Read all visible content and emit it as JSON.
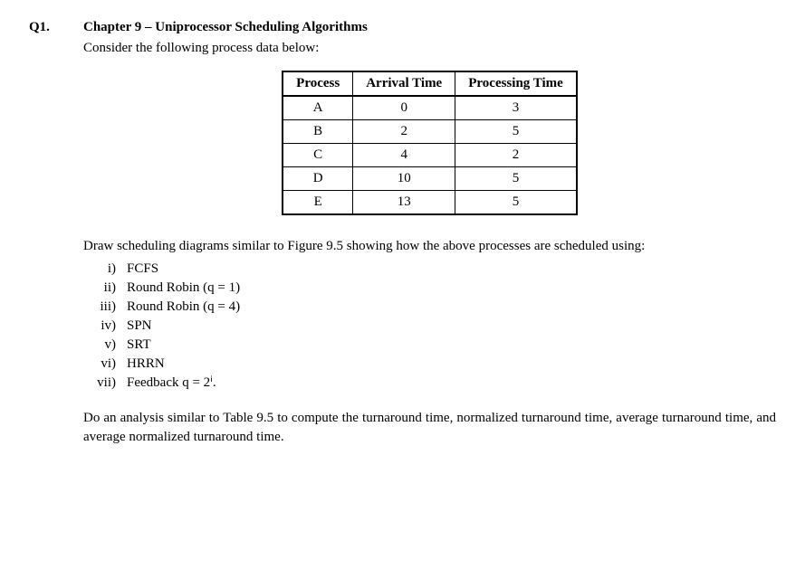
{
  "question_number": "Q1.",
  "chapter_title": "Chapter 9 – Uniprocessor Scheduling Algorithms",
  "intro_text": "Consider the following process data below:",
  "table": {
    "headers": [
      "Process",
      "Arrival Time",
      "Processing Time"
    ],
    "rows": [
      {
        "process": "A",
        "arrival": "0",
        "processing": "3"
      },
      {
        "process": "B",
        "arrival": "2",
        "processing": "5"
      },
      {
        "process": "C",
        "arrival": "4",
        "processing": "2"
      },
      {
        "process": "D",
        "arrival": "10",
        "processing": "5"
      },
      {
        "process": "E",
        "arrival": "13",
        "processing": "5"
      }
    ]
  },
  "draw_instruction": "Draw scheduling diagrams similar to Figure 9.5 showing how the above processes are scheduled using:",
  "scheduling_list": [
    {
      "roman": "i)",
      "text": "FCFS"
    },
    {
      "roman": "ii)",
      "text": "Round Robin (q = 1)"
    },
    {
      "roman": "iii)",
      "text": "Round Robin (q = 4)"
    },
    {
      "roman": "iv)",
      "text": "SPN"
    },
    {
      "roman": "v)",
      "text": "SRT"
    },
    {
      "roman": "vi)",
      "text": "HRRN"
    },
    {
      "roman": "vii)",
      "text": "Feedback q = 2ⁱ."
    }
  ],
  "analysis_instruction": "Do an analysis similar to Table 9.5 to compute the turnaround time, normalized turnaround time, average turnaround time, and average normalized turnaround time.",
  "chart_data": {
    "type": "table",
    "title": "Process Data",
    "columns": [
      "Process",
      "Arrival Time",
      "Processing Time"
    ],
    "rows": [
      [
        "A",
        0,
        3
      ],
      [
        "B",
        2,
        5
      ],
      [
        "C",
        4,
        2
      ],
      [
        "D",
        10,
        5
      ],
      [
        "E",
        13,
        5
      ]
    ]
  }
}
